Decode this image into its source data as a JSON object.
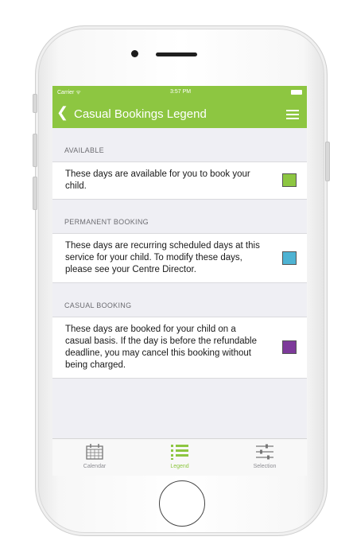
{
  "status_bar": {
    "carrier": "Carrier ᯤ",
    "time": "3:57 PM"
  },
  "nav": {
    "back_label": "Casual Bookings",
    "title": "Legend"
  },
  "sections": [
    {
      "header": "AVAILABLE",
      "text": "These days are available for you to book your child.",
      "color": "#8dc641"
    },
    {
      "header": "PERMANENT BOOKING",
      "text": "These days are recurring scheduled days at this service for your child. To modify these days, please see your Centre Director.",
      "color": "#4eb3d3"
    },
    {
      "header": "CASUAL BOOKING",
      "text": "These days are booked for your child on a casual basis. If the day is before the refundable deadline, you may cancel this booking without being charged.",
      "color": "#7d3a9a"
    }
  ],
  "tabs": [
    {
      "label": "Calendar",
      "icon": "calendar-icon",
      "active": false
    },
    {
      "label": "Legend",
      "icon": "list-icon",
      "active": true
    },
    {
      "label": "Selection",
      "icon": "sliders-icon",
      "active": false
    }
  ],
  "colors": {
    "accent": "#8dc641"
  }
}
